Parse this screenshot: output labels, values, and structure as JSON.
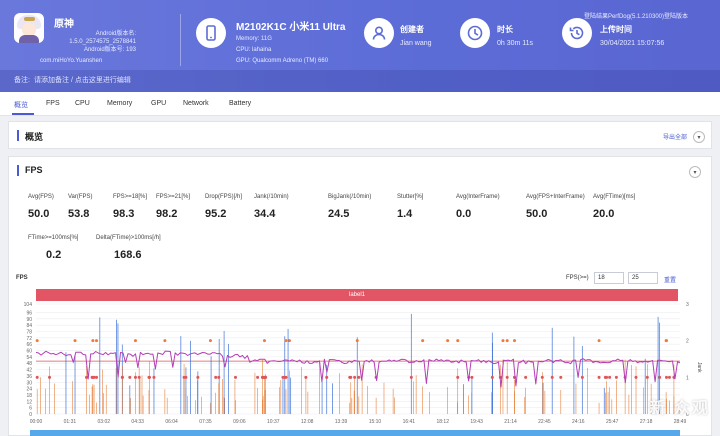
{
  "header": {
    "app_name": "原神",
    "app_lines": [
      "Android版本名:",
      "1.5.0_2574575_2578841",
      "Android版本号: 193"
    ],
    "package": "com.miHoYo.Yuanshen",
    "device_model": "M2102K1C 小米11 Ultra",
    "device_lines": [
      "Memory: 11G",
      "CPU: lahaina",
      "GPU: Qualcomm Adreno (TM) 660"
    ],
    "creator_title": "创建者",
    "creator_value": "Jian wang",
    "duration_title": "时长",
    "duration_value": "0h 30m 11s",
    "upload_title": "上传时间",
    "upload_value": "30/04/2021 15:07:56",
    "login_text": "登陆结果PerfDog(5.1.210300)登陆版本",
    "sub_label": "备注:",
    "sub_note": "请添加备注 / 点击这里进行编辑"
  },
  "tabs": [
    "概览",
    "FPS",
    "CPU",
    "Memory",
    "GPU",
    "Network",
    "Battery"
  ],
  "overview": {
    "title": "概览",
    "export": "导出全部"
  },
  "fps_section": {
    "title": "FPS",
    "stats_row1": [
      {
        "label": "Avg(FPS)",
        "value": "50.0"
      },
      {
        "label": "Var(FPS)",
        "value": "53.8"
      },
      {
        "label": "FPS>=18[%]",
        "value": "98.3"
      },
      {
        "label": "FPS>=21[%]",
        "value": "98.2"
      },
      {
        "label": "Drop(FPS)[/h]",
        "value": "95.2"
      },
      {
        "label": "Jank(/10min)",
        "value": "34.4"
      },
      {
        "label": "BigJank(/10min)",
        "value": "24.5"
      },
      {
        "label": "Stutter[%]",
        "value": "1.4"
      },
      {
        "label": "Avg(InterFrame)",
        "value": "0.0"
      },
      {
        "label": "Avg(FPS+InterFrame)",
        "value": "50.0"
      },
      {
        "label": "Avg(FTime)[ms]",
        "value": "20.0"
      }
    ],
    "stats_row2": [
      {
        "label": "FTime>=100ms[%]",
        "value": "0.2"
      },
      {
        "label": "Delta(FTime)>100ms[/h]",
        "value": "168.6"
      }
    ],
    "fps_eq_label": "FPS(>=)",
    "fps_eq_a": "18",
    "fps_eq_b": "25",
    "ok_label": "重置",
    "label_bar": "label1",
    "watermark": "新 众观"
  },
  "chart_data": {
    "type": "line",
    "ylabel": "FPS",
    "y2label": "Jank",
    "ylim": [
      0,
      104
    ],
    "y2lim": [
      0,
      3
    ],
    "yticks": [
      0,
      6,
      12,
      18,
      24,
      30,
      36,
      42,
      48,
      54,
      60,
      66,
      72,
      78,
      84,
      90,
      96,
      104
    ],
    "y2ticks": [
      0,
      1,
      2,
      3
    ],
    "xticks": [
      "00:00",
      "01:31",
      "03:02",
      "04:33",
      "06:04",
      "07:35",
      "09:06",
      "10:37",
      "12:08",
      "13:39",
      "15:10",
      "16:41",
      "18:12",
      "19:43",
      "21:14",
      "22:45",
      "24:16",
      "25:47",
      "27:18",
      "28:49"
    ],
    "series": [
      {
        "name": "FPS",
        "color": "#b33fb5",
        "values": [
          57,
          58,
          57,
          56,
          58,
          57,
          58,
          57,
          58,
          57,
          56,
          57,
          58,
          57,
          58,
          57,
          56,
          57,
          58,
          57,
          56,
          55,
          54,
          50,
          51,
          49,
          50,
          51,
          50,
          49,
          50,
          51,
          50,
          49,
          50,
          51,
          50,
          49,
          50,
          51,
          50,
          49,
          50,
          51,
          50,
          49,
          50,
          51,
          50,
          49,
          50,
          51,
          50,
          49,
          50,
          51,
          50,
          49,
          50,
          51,
          50,
          49,
          50,
          51,
          50,
          49,
          50,
          51,
          50,
          49
        ]
      },
      {
        "name": "Jank",
        "color": "#e36c1a"
      },
      {
        "name": "BigJank",
        "color": "#3a6fd8"
      }
    ],
    "baseline": {
      "name": "Avg",
      "value": 50,
      "color": "#e54d4d"
    }
  }
}
